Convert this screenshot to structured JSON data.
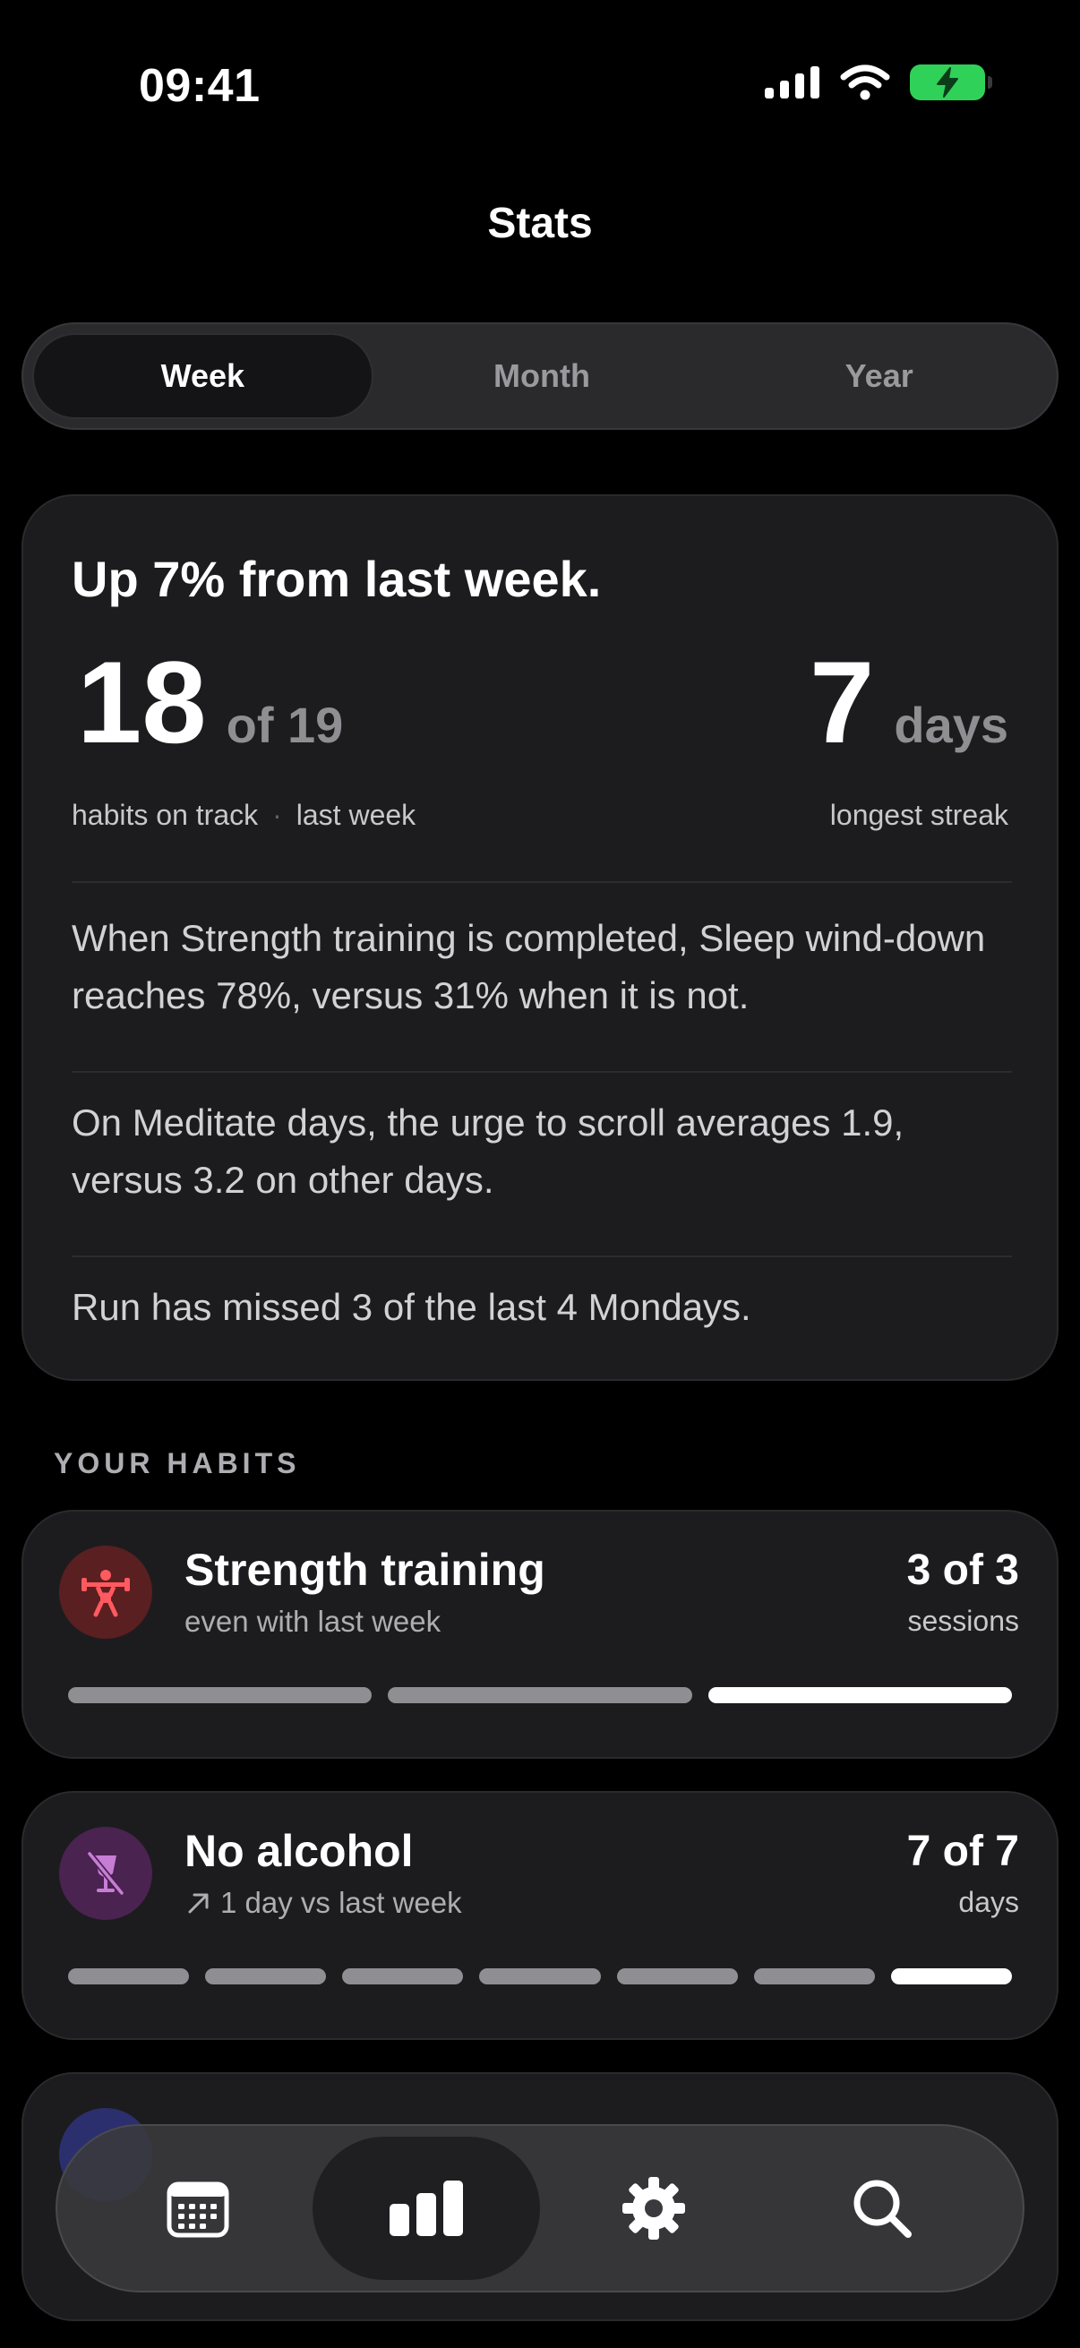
{
  "status": {
    "time": "09:41"
  },
  "header": {
    "title": "Stats"
  },
  "segments": [
    {
      "label": "Week",
      "active": true
    },
    {
      "label": "Month",
      "active": false
    },
    {
      "label": "Year",
      "active": false
    }
  ],
  "summary": {
    "heading": "Up 7% from last week.",
    "on_track_value": "18",
    "on_track_total": "of 19",
    "on_track_caption": "habits on track",
    "period_caption": "last week",
    "streak_value": "7",
    "streak_unit": "days",
    "streak_caption": "longest streak",
    "insights": [
      "When Strength training is completed, Sleep wind-down reaches 78%, versus 31% when it is not.",
      "On Meditate days, the urge to scroll averages 1.9, versus 3.2 on other days.",
      "Run has missed 3 of the last 4 Mondays."
    ]
  },
  "habits_section": {
    "label": "YOUR HABITS"
  },
  "habits": [
    {
      "name": "Strength training",
      "subtitle": "even with last week",
      "count": "3 of 3",
      "unit": "sessions",
      "icon": "weightlifting-icon",
      "icon_bg": "#5a1f21",
      "icon_color": "#ff5a5f",
      "progress": [
        true,
        true,
        true
      ]
    },
    {
      "name": "No alcohol",
      "subtitle": "1 day vs last week",
      "count": "7 of 7",
      "unit": "days",
      "icon": "no-alcohol-icon",
      "icon_bg": "#4a2350",
      "icon_color": "#c77dd6",
      "progress": [
        true,
        true,
        true,
        true,
        true,
        true,
        true
      ]
    }
  ],
  "tabbar": {
    "items": [
      {
        "name": "calendar",
        "active": false
      },
      {
        "name": "stats",
        "active": true
      },
      {
        "name": "settings",
        "active": false
      },
      {
        "name": "search",
        "active": false
      }
    ]
  },
  "colors": {
    "background": "#000000",
    "card": "#1c1c1e",
    "battery": "#30d158"
  }
}
